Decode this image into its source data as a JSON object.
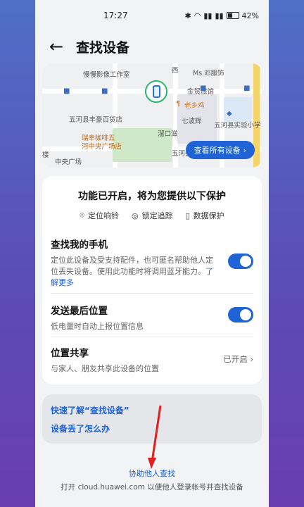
{
  "status_bar": {
    "time": "17:27",
    "battery": "42%"
  },
  "header": {
    "title": "查找设备"
  },
  "map": {
    "labels": [
      "慢慢影像工作室",
      "西",
      "Ms.邓服饰",
      "金贸旅馆",
      "老乡鸡",
      "五河县丰豪百货店",
      "七波辉",
      "五河县实验小学",
      "瑞幸咖啡五",
      "河中央广场店",
      "溜口滋",
      "五河县万福",
      "中央广场",
      "楼"
    ],
    "all_devices_btn": "查看所有设备"
  },
  "protection": {
    "title": "功能已开启，将为您提供以下保护",
    "features": [
      "定位响铃",
      "锁定追踪",
      "数据保护"
    ]
  },
  "find_phone": {
    "title": "查找我的手机",
    "desc": "定位此设备及受支持配件，也可匿名帮助他人定位丢失设备。使用此功能时将调用蓝牙能力。",
    "link": "了解更多",
    "enabled": true
  },
  "last_location": {
    "title": "发送最后位置",
    "desc": "低电量时自动上报位置信息",
    "enabled": true
  },
  "location_share": {
    "title": "位置共享",
    "desc": "与家人、朋友共享此设备的位置",
    "value": "已开启"
  },
  "links": {
    "learn": "快速了解“查找设备”",
    "lost": "设备丢了怎么办"
  },
  "footer": {
    "help": "协助他人查找",
    "note": "打开 cloud.huawei.com 以便他人登录帐号并查找设备"
  },
  "colors": {
    "accent": "#1f63d6",
    "annotation_arrow": "#e02020"
  }
}
